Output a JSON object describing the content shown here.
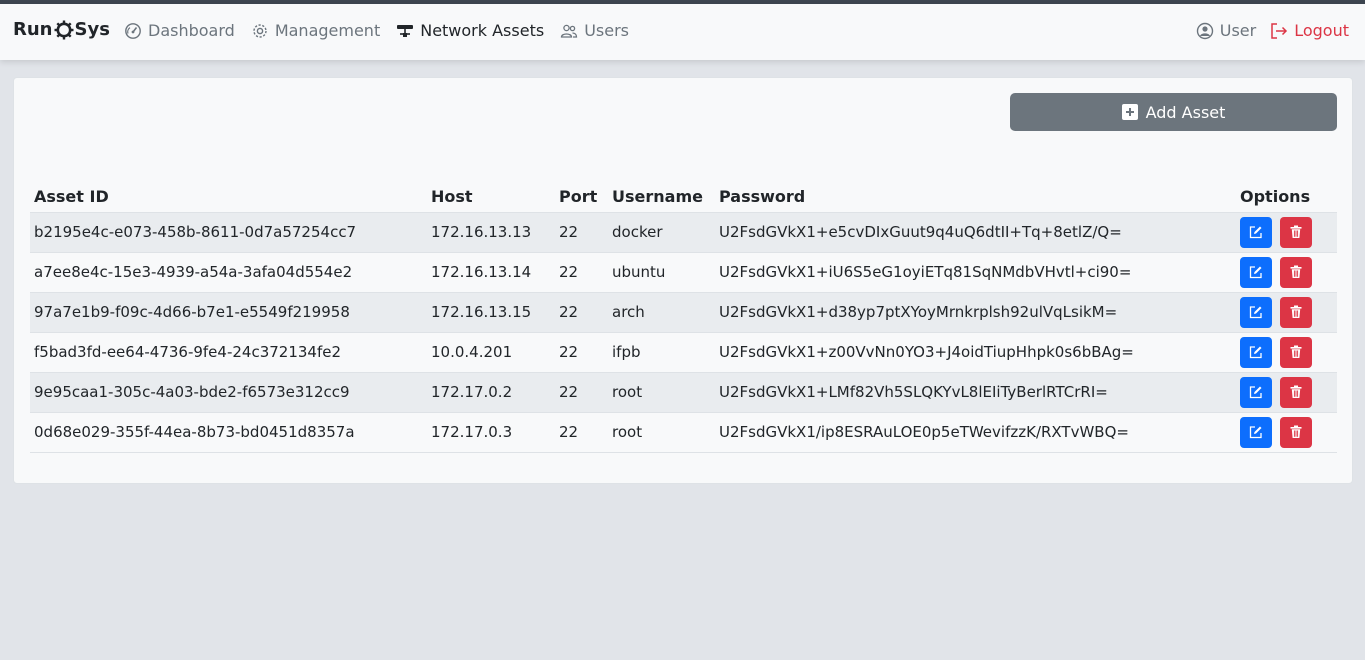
{
  "brand": {
    "left": "Run",
    "right": "Sys"
  },
  "nav": {
    "items": [
      {
        "label": "Dashboard",
        "icon": "speedometer-icon",
        "active": false
      },
      {
        "label": "Management",
        "icon": "gear-icon",
        "active": false
      },
      {
        "label": "Network Assets",
        "icon": "network-icon",
        "active": true
      },
      {
        "label": "Users",
        "icon": "people-icon",
        "active": false
      }
    ],
    "user_label": "User",
    "logout_label": "Logout"
  },
  "toolbar": {
    "add_label": "Add Asset"
  },
  "table": {
    "headers": [
      "Asset ID",
      "Host",
      "Port",
      "Username",
      "Password",
      "Options"
    ],
    "rows": [
      [
        "b2195e4c-e073-458b-8611-0d7a57254cc7",
        "172.16.13.13",
        "22",
        "docker",
        "U2FsdGVkX1+e5cvDIxGuut9q4uQ6dtII+Tq+8etlZ/Q="
      ],
      [
        "a7ee8e4c-15e3-4939-a54a-3afa04d554e2",
        "172.16.13.14",
        "22",
        "ubuntu",
        "U2FsdGVkX1+iU6S5eG1oyiETq81SqNMdbVHvtl+ci90="
      ],
      [
        "97a7e1b9-f09c-4d66-b7e1-e5549f219958",
        "172.16.13.15",
        "22",
        "arch",
        "U2FsdGVkX1+d38yp7ptXYoyMrnkrplsh92ulVqLsikM="
      ],
      [
        "f5bad3fd-ee64-4736-9fe4-24c372134fe2",
        "10.0.4.201",
        "22",
        "ifpb",
        "U2FsdGVkX1+z00VvNn0YO3+J4oidTiupHhpk0s6bBAg="
      ],
      [
        "9e95caa1-305c-4a03-bde2-f6573e312cc9",
        "172.17.0.2",
        "22",
        "root",
        "U2FsdGVkX1+LMf82Vh5SLQKYvL8lEIiTyBerlRTCrRI="
      ],
      [
        "0d68e029-355f-44ea-8b73-bd0451d8357a",
        "172.17.0.3",
        "22",
        "root",
        "U2FsdGVkX1/ip8ESRAuLOE0p5eTWevifzzK/RXTvWBQ="
      ]
    ]
  },
  "colors": {
    "primary": "#0d6efd",
    "danger": "#dc3545",
    "secondary": "#6c757d"
  }
}
